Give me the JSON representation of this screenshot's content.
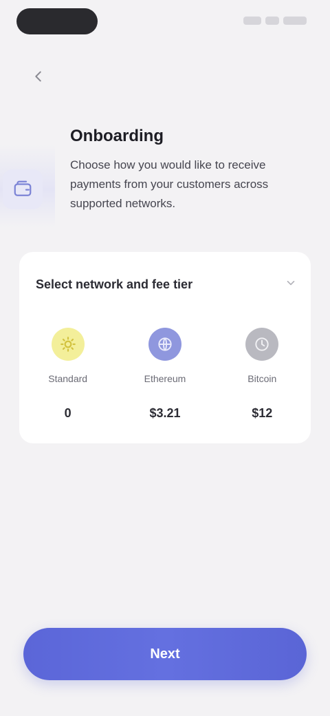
{
  "header": {
    "back_icon": "chevron-left-icon"
  },
  "hero": {
    "icon": "wallet-icon",
    "title": "Onboarding",
    "description": "Choose how you would like to receive payments from your customers across supported networks."
  },
  "card": {
    "title": "Select network and fee tier",
    "chevron_icon": "chevron-down-icon",
    "options": [
      {
        "icon": "sun-icon",
        "label": "Standard",
        "value": "0",
        "color": "#f3ef9a",
        "icon_color": "#d8c94a"
      },
      {
        "icon": "globe-icon",
        "label": "Ethereum",
        "value": "$3.21",
        "color": "#8f97de",
        "icon_color": "#6f78d0"
      },
      {
        "icon": "clock-icon",
        "label": "Bitcoin",
        "value": "$12",
        "color": "#b9b9c0",
        "icon_color": "#8e8e96"
      }
    ]
  },
  "cta": {
    "label": "Next"
  },
  "colors": {
    "accent": "#5b66d8",
    "background": "#f3f2f4",
    "card": "#ffffff"
  }
}
